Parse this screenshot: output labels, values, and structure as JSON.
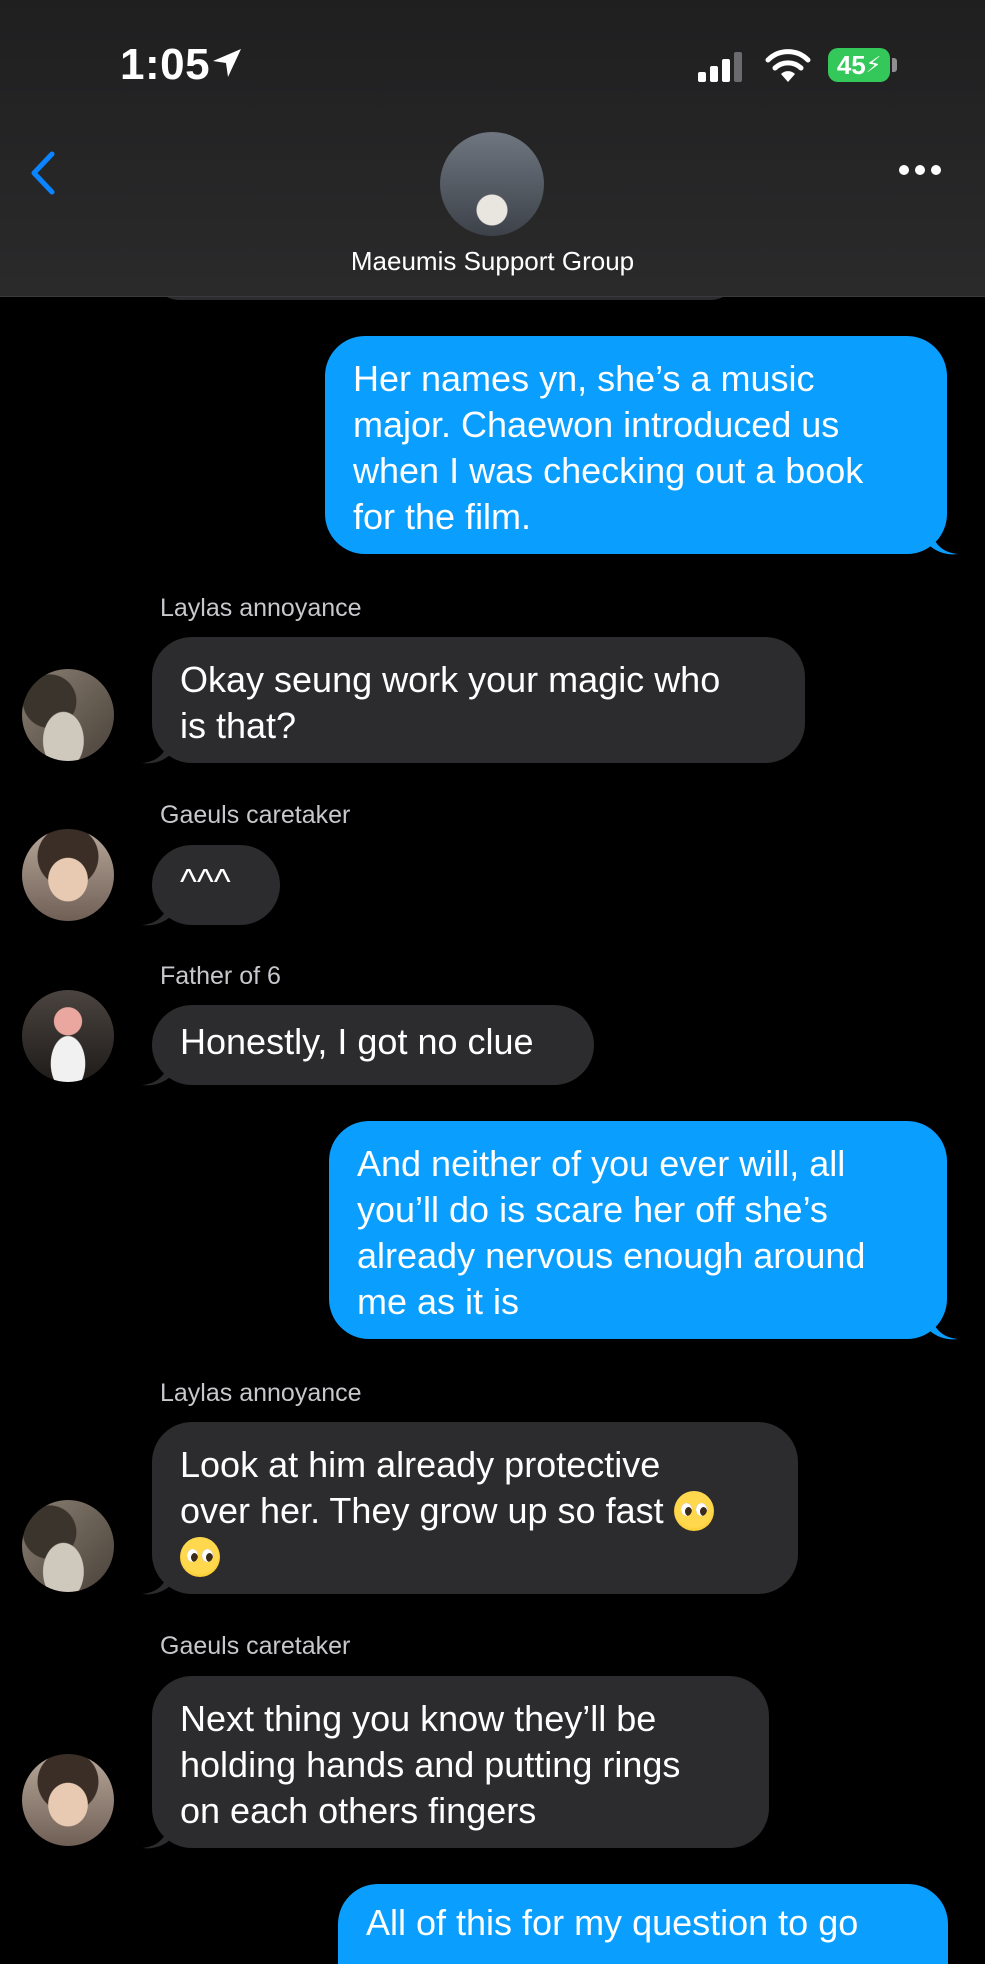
{
  "status_bar": {
    "time": "1:05",
    "battery": "45"
  },
  "header": {
    "group_name": "Maeumis Support Group"
  },
  "messages": [
    {
      "direction": "outgoing",
      "lines": [
        "Her names yn, she’s a music",
        "major. Chaewon introduced us",
        "when I was checking out a book",
        "for the film."
      ]
    },
    {
      "direction": "incoming",
      "sender": "Laylas annoyance",
      "lines": [
        "Okay seung work your magic who",
        "is that?"
      ]
    },
    {
      "direction": "incoming",
      "sender": "Gaeuls caretaker",
      "lines": [
        "^^^"
      ]
    },
    {
      "direction": "incoming",
      "sender": "Father of 6",
      "lines": [
        "Honestly, I got no clue"
      ]
    },
    {
      "direction": "outgoing",
      "lines": [
        "And neither of you ever will, all",
        "you’ll do is scare her off she’s",
        "already nervous enough around",
        "me as it is"
      ]
    },
    {
      "direction": "incoming",
      "sender": "Laylas annoyance",
      "lines": [
        "Look at him already protective",
        "over her. They grow up so fast"
      ]
    },
    {
      "direction": "incoming",
      "sender": "Gaeuls caretaker",
      "lines": [
        "Next thing you know they’ll be",
        "holding hands and putting rings",
        "on each others fingers"
      ]
    },
    {
      "direction": "outgoing",
      "lines": [
        "All of this for my question to go"
      ]
    }
  ]
}
